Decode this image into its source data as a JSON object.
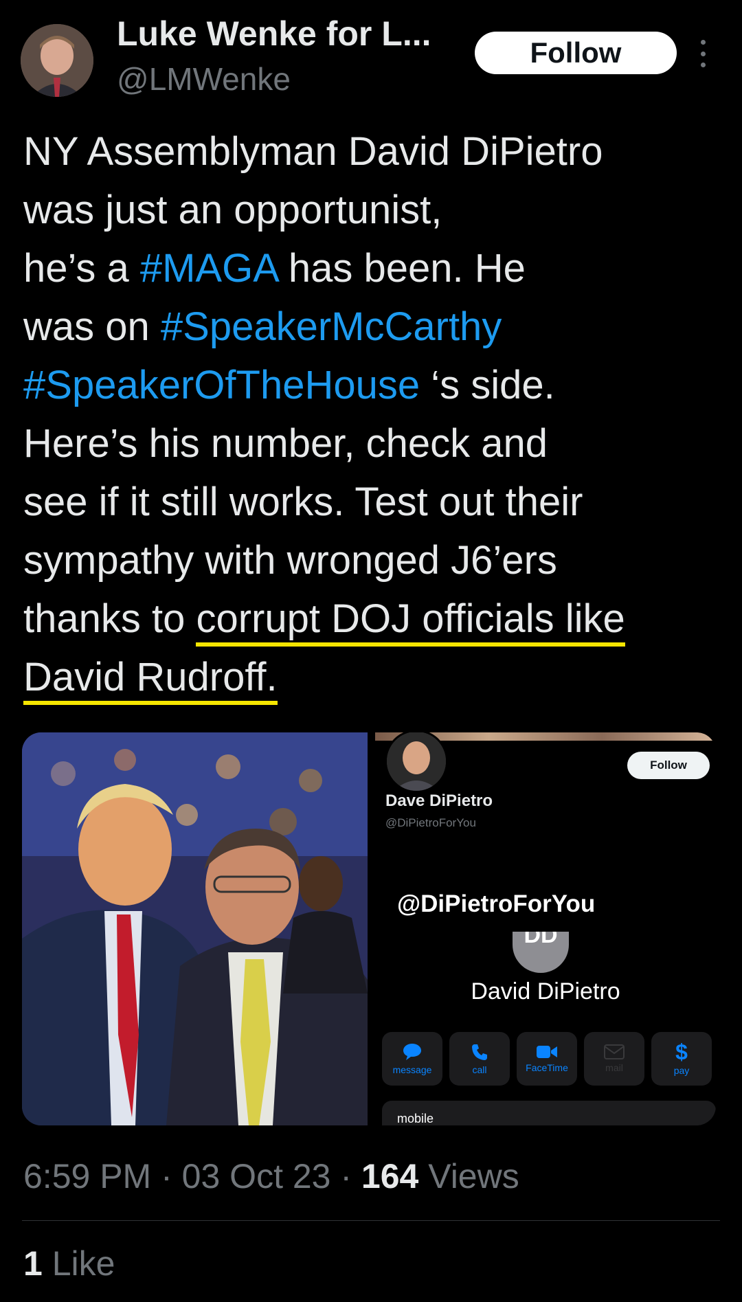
{
  "tweet": {
    "author_name": "Luke Wenke for L...",
    "author_handle": "@LMWenke",
    "follow_label": "Follow",
    "text_lines": [
      "NY Assemblyman David DiPietro",
      "was just an opportunist,"
    ],
    "line3_pre": "he’s a ",
    "tag_maga": "#MAGA",
    "line3_post": " has been. He",
    "line4_pre": "was on ",
    "tag_speaker_mccarthy": "#SpeakerMcCarthy",
    "tag_speaker_house": "#SpeakerOfTheHouse",
    "line5_post": " ‘s side.",
    "line6": "Here’s his number, check and",
    "line7": "see if it still works. Test out their",
    "line8": "sympathy with wronged J6’ers",
    "line9_pre": "thanks to ",
    "line9_highlight": "corrupt DOJ officials like",
    "line10_highlight": "David Rudroff.",
    "time": "6:59 PM",
    "date": "03 Oct 23",
    "views_count": "164",
    "views_label": " Views",
    "likes_count": "1",
    "likes_label": " Like"
  },
  "embedded_profile": {
    "follow_label": "Follow",
    "name": "Dave DiPietro",
    "handle": "@DiPietroForYou",
    "overlay_handle": "@DiPietroForYou",
    "contact_initials": "DD",
    "contact_name": "David DiPietro",
    "actions": [
      {
        "label": "message",
        "icon": "message-icon",
        "enabled": true
      },
      {
        "label": "call",
        "icon": "phone-icon",
        "enabled": true
      },
      {
        "label": "FaceTime",
        "icon": "video-icon",
        "enabled": true
      },
      {
        "label": "mail",
        "icon": "mail-icon",
        "enabled": false
      },
      {
        "label": "pay",
        "icon": "dollar-icon",
        "enabled": true
      }
    ],
    "field_label": "mobile"
  },
  "colors": {
    "accent": "#1d9bf0",
    "highlight_underline": "#f5e500",
    "ios_blue": "#0a84ff"
  }
}
